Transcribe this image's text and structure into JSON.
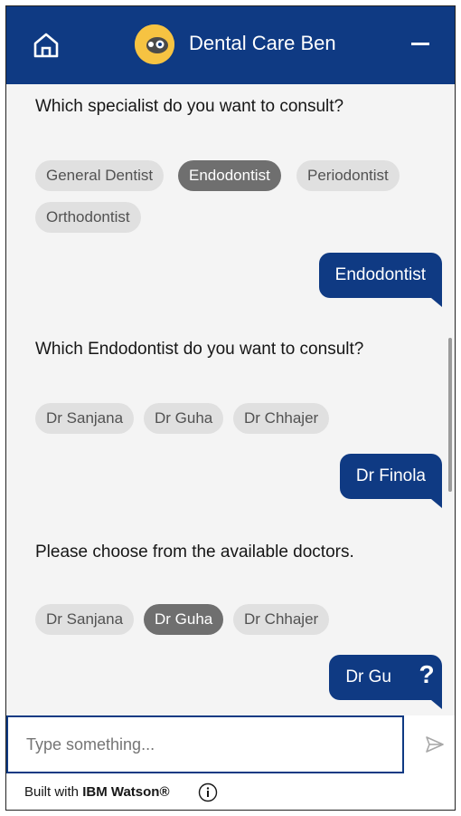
{
  "header": {
    "title": "Dental Care Ben"
  },
  "conversation": {
    "q1": "Which specialist do you want to consult?",
    "chips1": [
      "General Dentist",
      "Endodontist",
      "Periodontist",
      "Orthodontist"
    ],
    "r1": "Endodontist",
    "q2": "Which Endodontist do you want to consult?",
    "chips2": [
      "Dr Sanjana",
      "Dr Guha",
      "Dr Chhajer"
    ],
    "r2": "Dr Finola",
    "q3": "Please choose from the available doctors.",
    "chips3": [
      "Dr Sanjana",
      "Dr Guha",
      "Dr Chhajer"
    ],
    "r3": "Dr Gu",
    "help": "?"
  },
  "input": {
    "placeholder": "Type something..."
  },
  "footer": {
    "prefix": "Built with",
    "brand": "IBM Watson®"
  },
  "colors": {
    "brand": "#0f3a83",
    "chip": "#e0e0e0",
    "chip_selected": "#6f6f6f"
  }
}
